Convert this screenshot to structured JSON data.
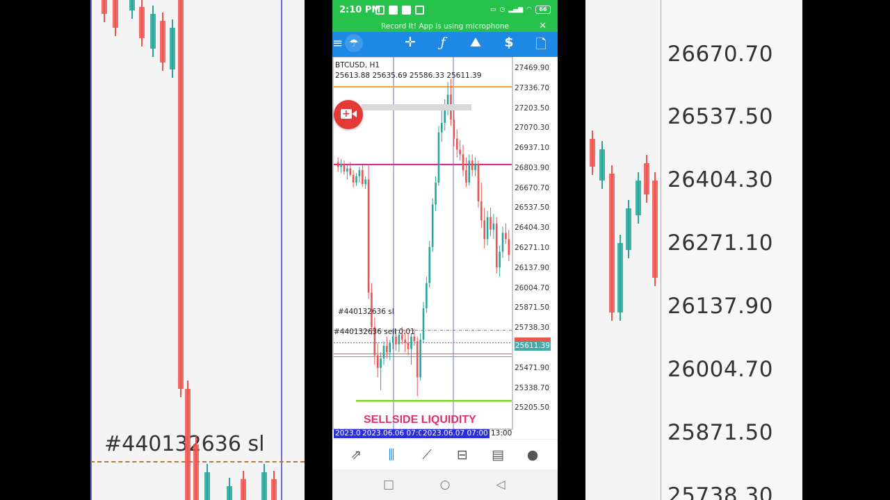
{
  "status_bar": {
    "time": "2:10 PM",
    "battery": "66",
    "colors": {
      "bar": "#27c24c"
    }
  },
  "recording_banner": {
    "text": "Record It! App is using microphone",
    "close_icon": "close-icon"
  },
  "toolbar": {
    "items": [
      {
        "name": "menu-icon",
        "glyph": "≡"
      },
      {
        "name": "app-logo-icon",
        "glyph": "☂"
      },
      {
        "name": "crosshair-icon",
        "glyph": "✛"
      },
      {
        "name": "indicators-icon",
        "glyph": "ƒ"
      },
      {
        "name": "objects-icon",
        "glyph": "⛰"
      },
      {
        "name": "trade-icon",
        "glyph": "$"
      },
      {
        "name": "new-order-icon",
        "glyph": "🗋"
      }
    ],
    "color": "#1e88e5"
  },
  "chart": {
    "symbol": "BTCUSD, H1",
    "ohlc": "25613.88 25635.69 25586.33 25611.39",
    "order_label_1": "#440132636 sl",
    "order_label_2": "#440132636 sell 0.01",
    "annotation": "SELLSIDE LIQUIDITY",
    "bid_tag": "25611.39",
    "price_axis": [
      "27469.90",
      "27336.70",
      "27203.50",
      "27070.30",
      "26937.10",
      "26803.90",
      "26670.70",
      "26537.50",
      "26404.30",
      "26271.10",
      "26137.90",
      "26004.70",
      "25871.50",
      "25738.30",
      "25611.39",
      "25471.90",
      "25338.70",
      "25205.50"
    ],
    "time_axis": [
      {
        "text": "2023.06",
        "highlight": true
      },
      {
        "text": "2023.06.06 07:00",
        "highlight": true
      },
      {
        "text": "2023.06.07 07:00",
        "highlight": true
      },
      {
        "text": "13:00",
        "highlight": false
      }
    ],
    "colors": {
      "up": "#26a69a",
      "down": "#ef5350",
      "resistance": "#f5a623",
      "supply": "#d81b8c",
      "support": "#7cd320",
      "vline": "#6b6bd0",
      "sl": "#b07a3c"
    }
  },
  "chart_data": {
    "type": "candlestick",
    "symbol": "BTCUSD",
    "timeframe": "H1",
    "ylim": [
      25150,
      27520
    ],
    "levels": {
      "resistance": 27330,
      "supply": 26835,
      "support": 25330,
      "stop_loss": 25780,
      "sell_entry": 25700,
      "bid": 25611.39
    },
    "series": [
      {
        "o": 26850,
        "h": 26880,
        "l": 26790,
        "c": 26820
      },
      {
        "o": 26820,
        "h": 26870,
        "l": 26780,
        "c": 26840
      },
      {
        "o": 26840,
        "h": 26860,
        "l": 26770,
        "c": 26790
      },
      {
        "o": 26790,
        "h": 26830,
        "l": 26740,
        "c": 26810
      },
      {
        "o": 26810,
        "h": 26850,
        "l": 26760,
        "c": 26770
      },
      {
        "o": 26770,
        "h": 26800,
        "l": 26690,
        "c": 26720
      },
      {
        "o": 26720,
        "h": 26780,
        "l": 26700,
        "c": 26760
      },
      {
        "o": 26760,
        "h": 26820,
        "l": 26720,
        "c": 26800
      },
      {
        "o": 26800,
        "h": 26830,
        "l": 26690,
        "c": 26710
      },
      {
        "o": 26710,
        "h": 26760,
        "l": 26680,
        "c": 26740
      },
      {
        "o": 26740,
        "h": 26830,
        "l": 25980,
        "c": 26020
      },
      {
        "o": 26020,
        "h": 26080,
        "l": 25750,
        "c": 25800
      },
      {
        "o": 25800,
        "h": 25860,
        "l": 25560,
        "c": 25620
      },
      {
        "o": 25620,
        "h": 25700,
        "l": 25480,
        "c": 25540
      },
      {
        "o": 25540,
        "h": 25640,
        "l": 25400,
        "c": 25600
      },
      {
        "o": 25600,
        "h": 25710,
        "l": 25560,
        "c": 25680
      },
      {
        "o": 25680,
        "h": 25740,
        "l": 25600,
        "c": 25640
      },
      {
        "o": 25640,
        "h": 25720,
        "l": 25590,
        "c": 25700
      },
      {
        "o": 25700,
        "h": 25780,
        "l": 25660,
        "c": 25740
      },
      {
        "o": 25740,
        "h": 25790,
        "l": 25650,
        "c": 25690
      },
      {
        "o": 25690,
        "h": 25770,
        "l": 25640,
        "c": 25750
      },
      {
        "o": 25750,
        "h": 25800,
        "l": 25690,
        "c": 25720
      },
      {
        "o": 25720,
        "h": 25780,
        "l": 25640,
        "c": 25700
      },
      {
        "o": 25700,
        "h": 25760,
        "l": 25620,
        "c": 25660
      },
      {
        "o": 25660,
        "h": 25760,
        "l": 25560,
        "c": 25740
      },
      {
        "o": 25740,
        "h": 25790,
        "l": 25680,
        "c": 25710
      },
      {
        "o": 25710,
        "h": 25740,
        "l": 25360,
        "c": 25480
      },
      {
        "o": 25480,
        "h": 25760,
        "l": 25460,
        "c": 25720
      },
      {
        "o": 25720,
        "h": 25960,
        "l": 25700,
        "c": 25920
      },
      {
        "o": 25920,
        "h": 26120,
        "l": 25890,
        "c": 26080
      },
      {
        "o": 26080,
        "h": 26350,
        "l": 26050,
        "c": 26310
      },
      {
        "o": 26310,
        "h": 26620,
        "l": 26280,
        "c": 26580
      },
      {
        "o": 26580,
        "h": 26760,
        "l": 26540,
        "c": 26720
      },
      {
        "o": 26720,
        "h": 27080,
        "l": 26700,
        "c": 27040
      },
      {
        "o": 27040,
        "h": 27180,
        "l": 26980,
        "c": 27100
      },
      {
        "o": 27100,
        "h": 27250,
        "l": 27050,
        "c": 27200
      },
      {
        "o": 27200,
        "h": 27360,
        "l": 27150,
        "c": 27280
      },
      {
        "o": 27280,
        "h": 27380,
        "l": 27080,
        "c": 27120
      },
      {
        "o": 27120,
        "h": 27180,
        "l": 26950,
        "c": 27000
      },
      {
        "o": 27000,
        "h": 27060,
        "l": 26880,
        "c": 26930
      },
      {
        "o": 26930,
        "h": 26990,
        "l": 26860,
        "c": 26900
      },
      {
        "o": 26900,
        "h": 26960,
        "l": 26760,
        "c": 26800
      },
      {
        "o": 26800,
        "h": 26880,
        "l": 26690,
        "c": 26720
      },
      {
        "o": 26720,
        "h": 26900,
        "l": 26700,
        "c": 26860
      },
      {
        "o": 26860,
        "h": 26900,
        "l": 26760,
        "c": 26800
      },
      {
        "o": 26800,
        "h": 26880,
        "l": 26760,
        "c": 26840
      },
      {
        "o": 26840,
        "h": 26860,
        "l": 26560,
        "c": 26600
      },
      {
        "o": 26600,
        "h": 26720,
        "l": 26430,
        "c": 26480
      },
      {
        "o": 26480,
        "h": 26560,
        "l": 26300,
        "c": 26360
      },
      {
        "o": 26360,
        "h": 26540,
        "l": 26320,
        "c": 26500
      },
      {
        "o": 26500,
        "h": 26560,
        "l": 26380,
        "c": 26420
      },
      {
        "o": 26420,
        "h": 26520,
        "l": 26360,
        "c": 26460
      },
      {
        "o": 26460,
        "h": 26500,
        "l": 26140,
        "c": 26180
      },
      {
        "o": 26180,
        "h": 26320,
        "l": 26120,
        "c": 26280
      },
      {
        "o": 26280,
        "h": 26440,
        "l": 26240,
        "c": 26400
      },
      {
        "o": 26400,
        "h": 26460,
        "l": 26330,
        "c": 26360
      },
      {
        "o": 26360,
        "h": 26420,
        "l": 26220,
        "c": 26260
      }
    ]
  },
  "bottom_tabs": [
    {
      "name": "tab-quotes",
      "glyph": "⇅",
      "active": false
    },
    {
      "name": "tab-chart",
      "glyph": "⫼",
      "active": true
    },
    {
      "name": "tab-trade",
      "glyph": "⟋",
      "active": false
    },
    {
      "name": "tab-history",
      "glyph": "⊟",
      "active": false
    },
    {
      "name": "tab-news",
      "glyph": "▤",
      "active": false
    },
    {
      "name": "tab-messages",
      "glyph": "💬",
      "active": false
    }
  ],
  "nav_bar": [
    {
      "name": "recents-button",
      "glyph": "□"
    },
    {
      "name": "home-button",
      "glyph": "○"
    },
    {
      "name": "back-button",
      "glyph": "◁"
    }
  ],
  "background": {
    "right_prices": [
      "26670.70",
      "26537.50",
      "26404.30",
      "26271.10",
      "26137.90",
      "26004.70",
      "25871.50",
      "25738.30"
    ],
    "left_sl": "#440132636 sl"
  }
}
